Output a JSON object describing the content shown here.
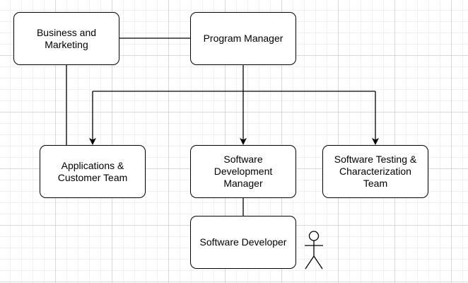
{
  "nodes": {
    "business": "Business and\nMarketing",
    "program": "Program Manager",
    "apps": "Applications &\nCustomer Team",
    "swdev": "Software\nDevelopment\nManager",
    "swtest": "Software Testing &\nCharacterization\nTeam",
    "dev": "Software Developer"
  },
  "icons": {
    "actor": "stick-figure-icon"
  },
  "colors": {
    "stroke": "#000000",
    "node_fill": "#ffffff",
    "grid_major": "#d9d9d9",
    "grid_minor": "#f0f0f0"
  }
}
